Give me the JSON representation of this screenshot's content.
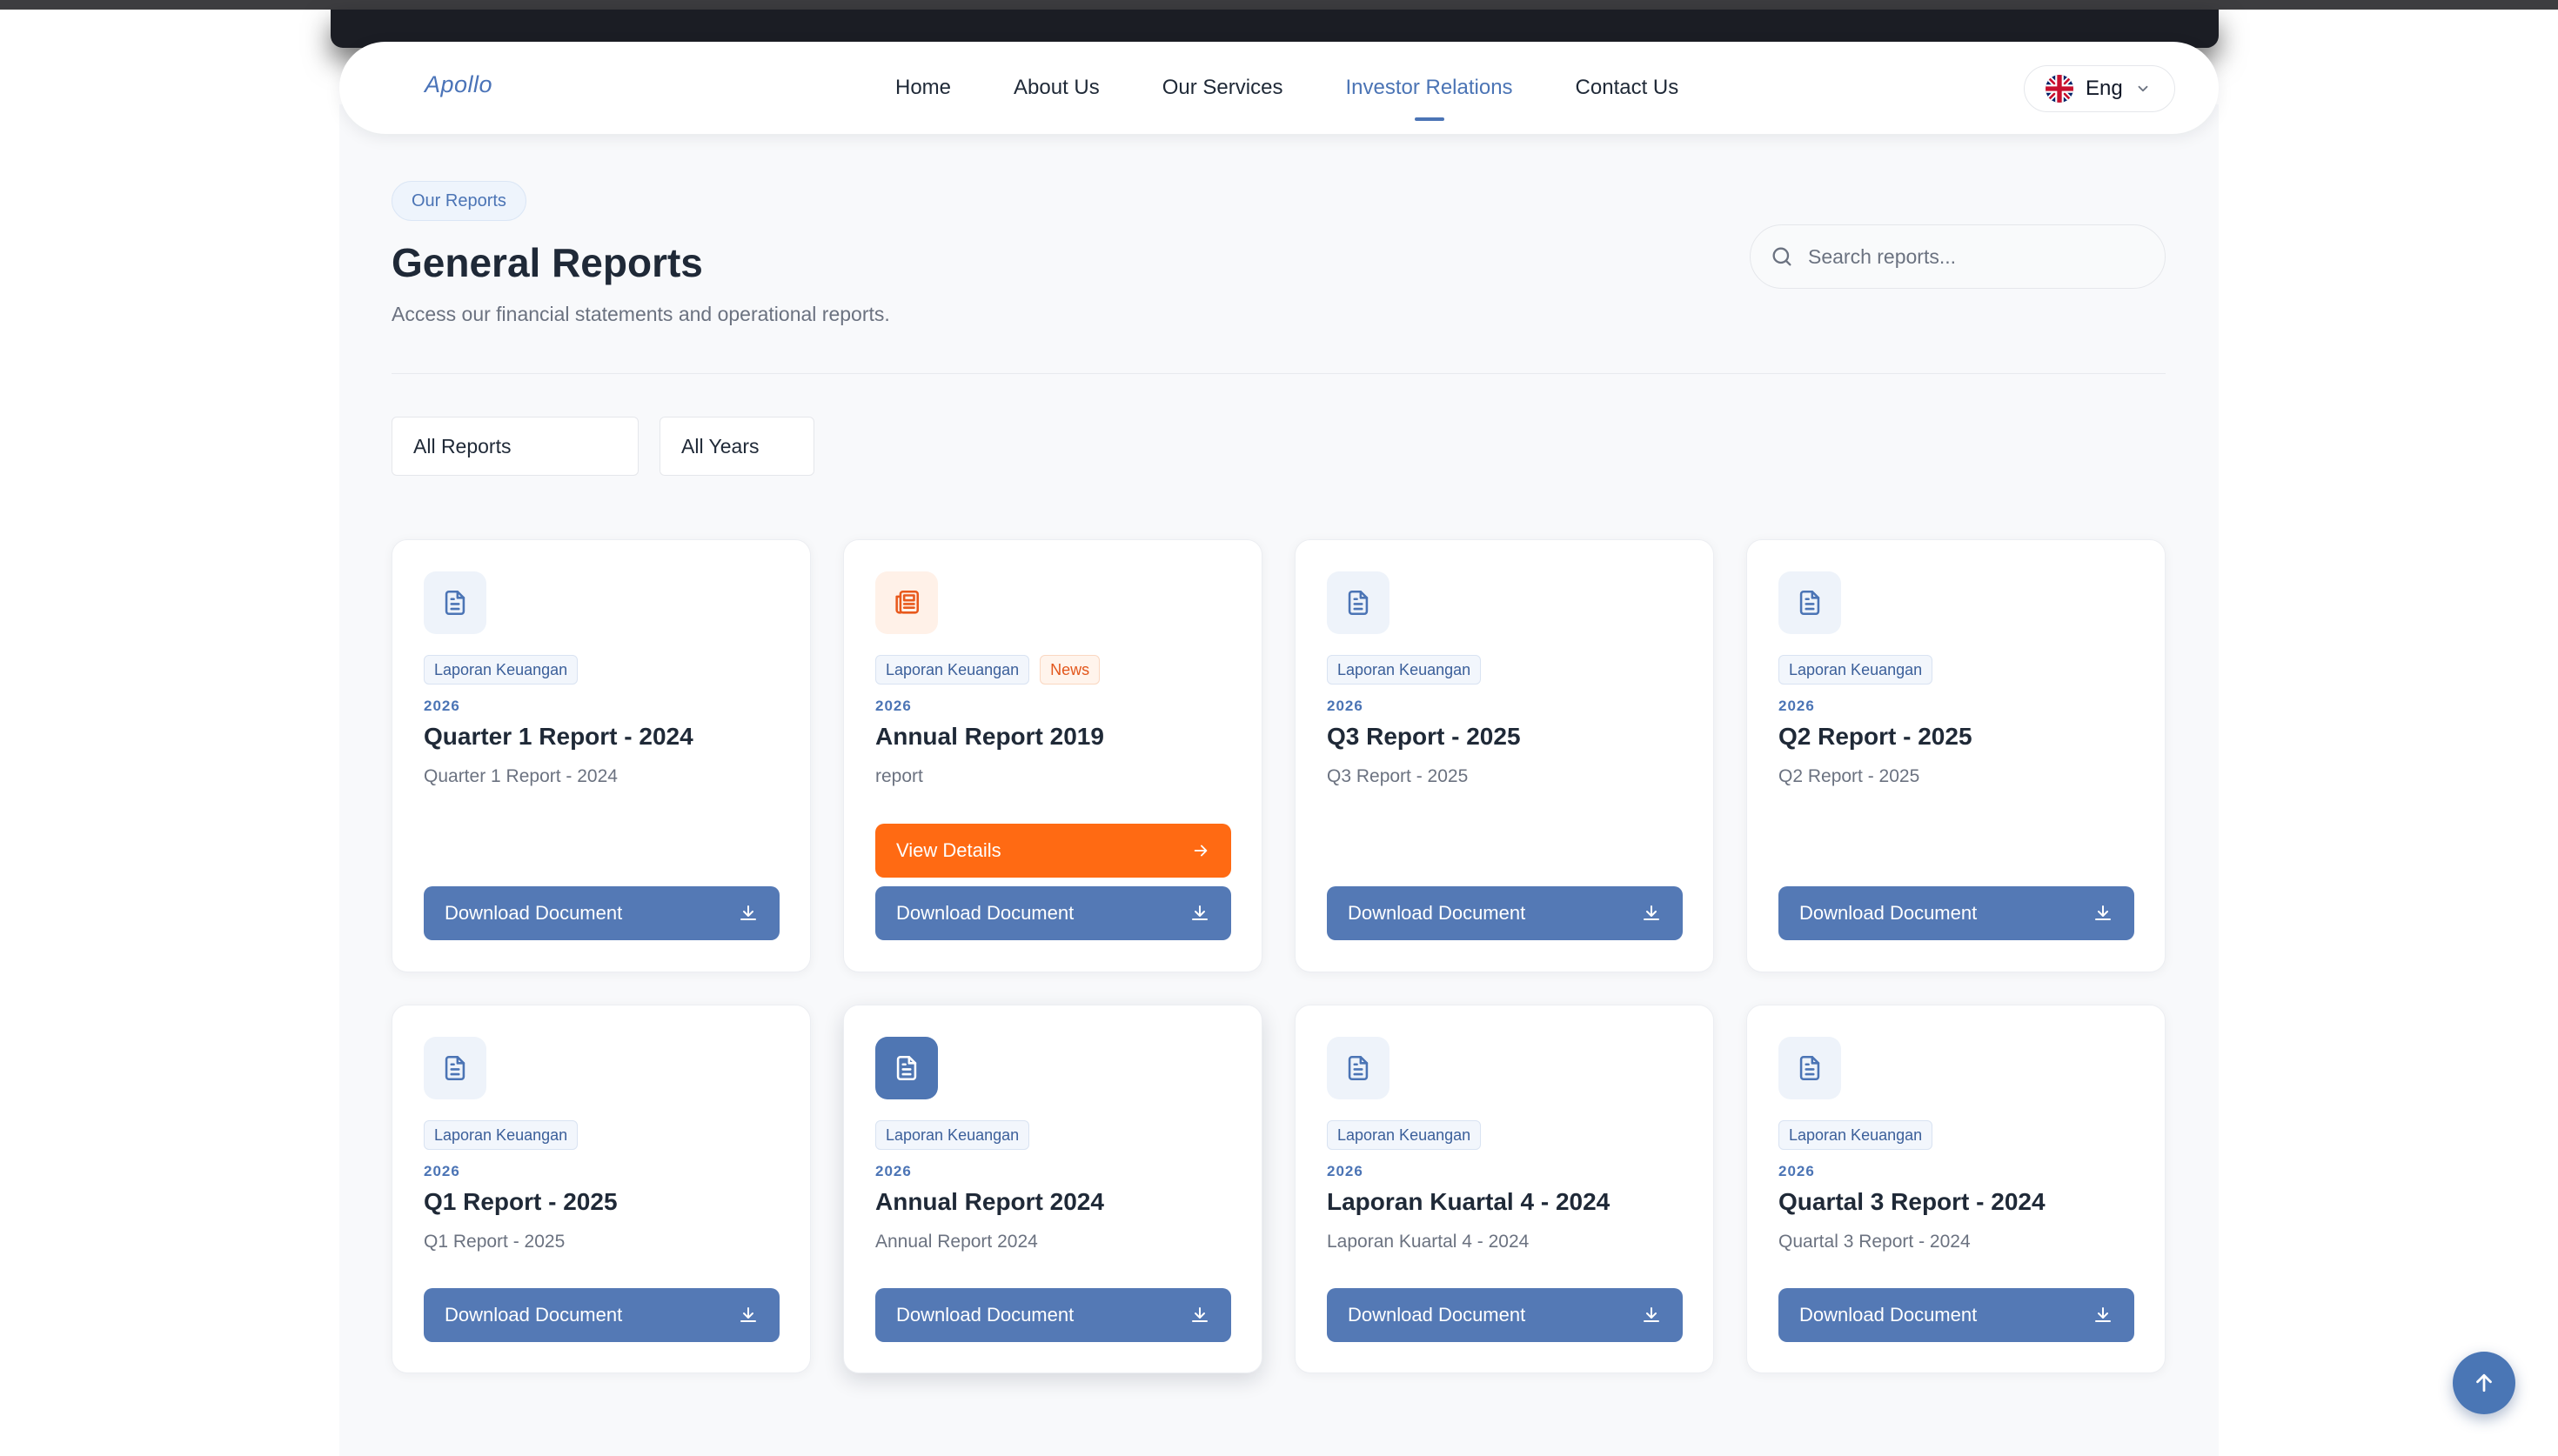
{
  "nav": {
    "logo": "Apollo",
    "links": [
      "Home",
      "About Us",
      "Our Services",
      "Investor Relations",
      "Contact Us"
    ],
    "active_link": "Investor Relations",
    "language": "Eng"
  },
  "header": {
    "badge": "Our Reports",
    "title": "General Reports",
    "subtitle": "Access our financial statements and operational reports.",
    "search_placeholder": "Search reports..."
  },
  "filters": {
    "type": "All Reports",
    "year": "All Years"
  },
  "cards": [
    {
      "tag": "Laporan Keuangan",
      "year": "2026",
      "title": "Quarter 1 Report - 2024",
      "desc": "Quarter 1 Report - 2024",
      "download": "Download Document",
      "icon": "document-icon"
    },
    {
      "tag": "Laporan Keuangan",
      "tag2": "News",
      "year": "2026",
      "title": "Annual Report 2019",
      "desc": "report",
      "view": "View Details",
      "download": "Download Document",
      "icon": "newspaper-icon"
    },
    {
      "tag": "Laporan Keuangan",
      "year": "2026",
      "title": "Q3 Report - 2025",
      "desc": "Q3 Report - 2025",
      "download": "Download Document",
      "icon": "document-icon"
    },
    {
      "tag": "Laporan Keuangan",
      "year": "2026",
      "title": "Q2 Report - 2025",
      "desc": "Q2 Report - 2025",
      "download": "Download Document",
      "icon": "document-icon"
    },
    {
      "tag": "Laporan Keuangan",
      "year": "2026",
      "title": "Q1 Report - 2025",
      "desc": "Q1 Report - 2025",
      "download": "Download Document",
      "icon": "document-icon"
    },
    {
      "tag": "Laporan Keuangan",
      "year": "2026",
      "title": "Annual Report 2024",
      "desc": "Annual Report 2024",
      "download": "Download Document",
      "icon": "document-icon"
    },
    {
      "tag": "Laporan Keuangan",
      "year": "2026",
      "title": "Laporan Kuartal 4 - 2024",
      "desc": "Laporan Kuartal 4 - 2024",
      "download": "Download Document",
      "icon": "document-icon"
    },
    {
      "tag": "Laporan Keuangan",
      "year": "2026",
      "title": "Quartal 3 Report - 2024",
      "desc": "Quartal 3 Report - 2024",
      "download": "Download Document",
      "icon": "document-icon"
    }
  ],
  "colors": {
    "accent": "#4b74b5",
    "button_primary": "#5479b5",
    "button_view": "#ff6a13",
    "news_tag": "#e2561b"
  }
}
